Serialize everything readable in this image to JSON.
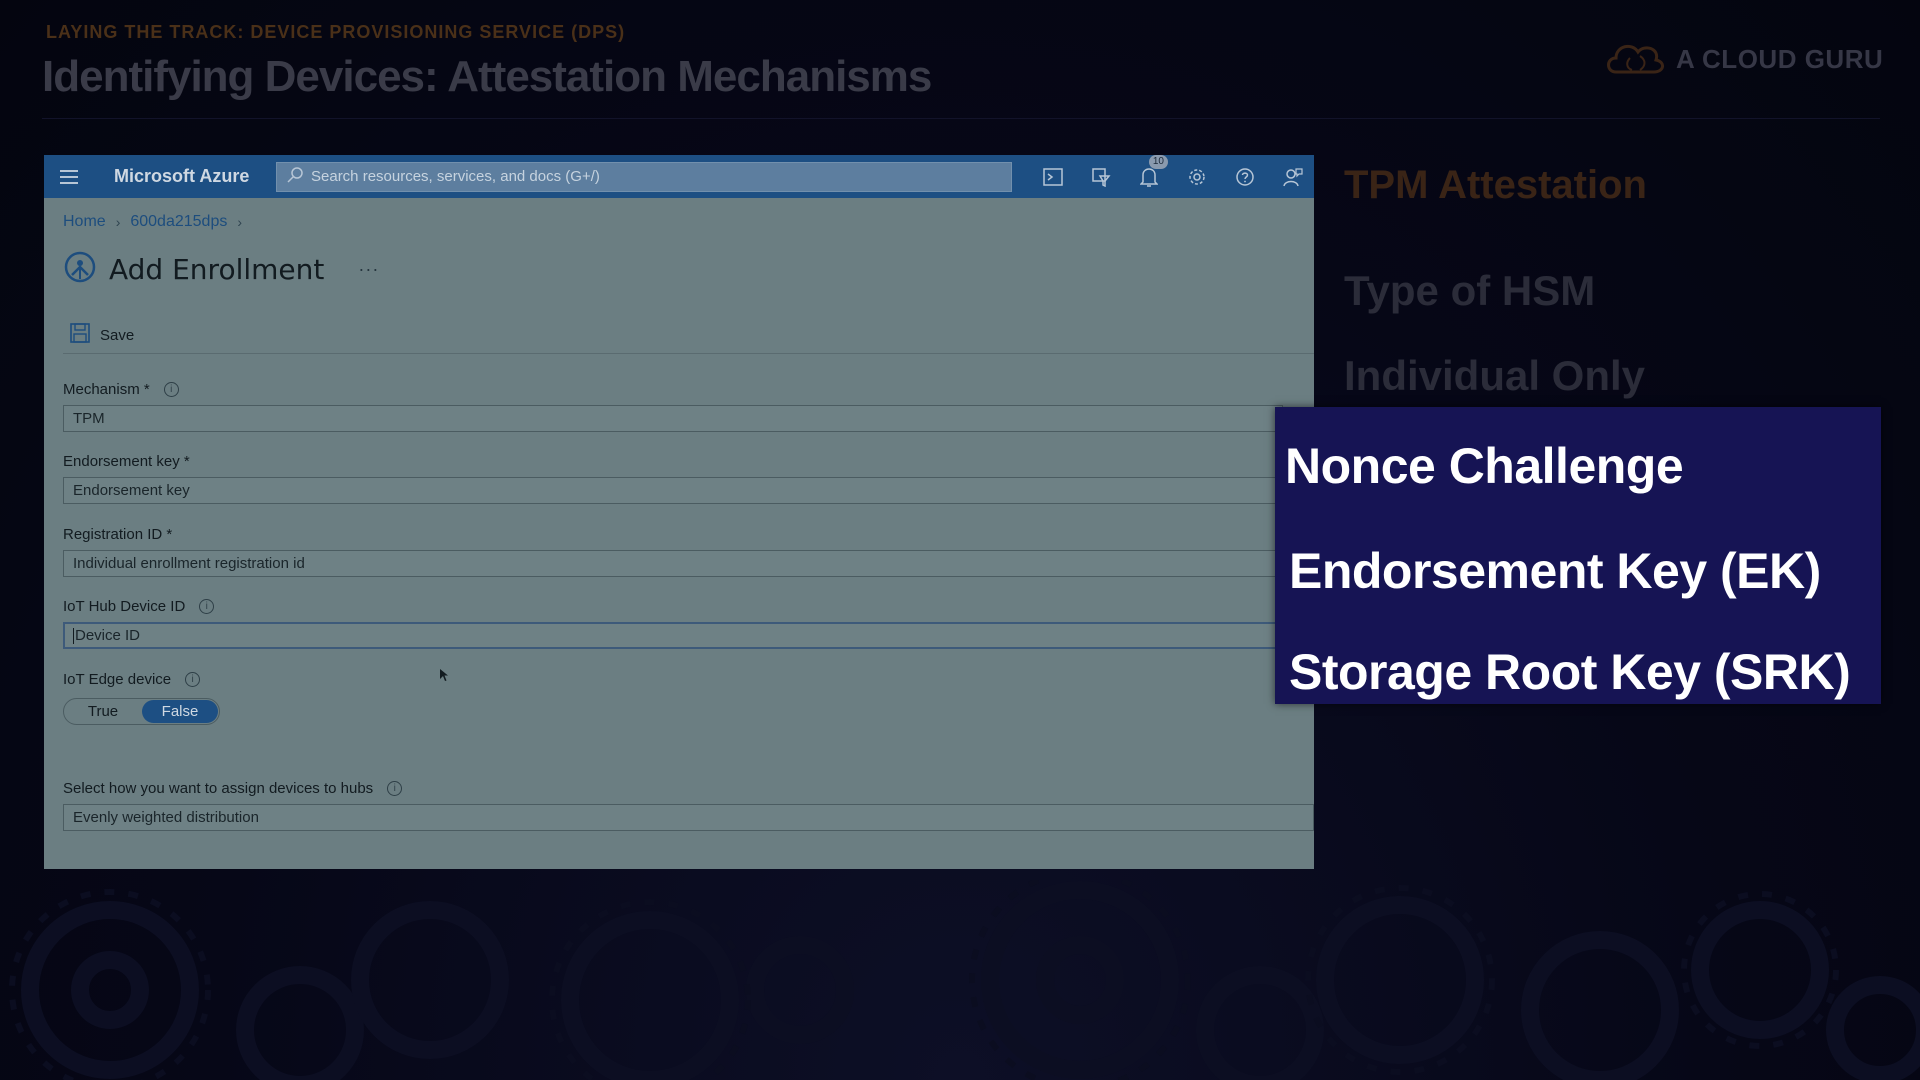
{
  "slide": {
    "subtitle": "LAYING THE TRACK: DEVICE PROVISIONING SERVICE (DPS)",
    "title": "Identifying Devices: Attestation Mechanisms",
    "brand": "A CLOUD GURU"
  },
  "portal": {
    "brand": "Microsoft Azure",
    "search_placeholder": "Search resources, services, and docs (G+/)",
    "notification_count": "10",
    "breadcrumb": [
      "Home",
      "600da215dps"
    ],
    "page_title": "Add Enrollment",
    "more_label": "···",
    "save_label": "Save",
    "fields": {
      "mechanism": {
        "label": "Mechanism *",
        "value": "TPM"
      },
      "endorsement_key": {
        "label": "Endorsement key *",
        "placeholder": "Endorsement key"
      },
      "registration_id": {
        "label": "Registration ID *",
        "placeholder": "Individual enrollment registration id"
      },
      "iot_hub_device_id": {
        "label": "IoT Hub Device ID",
        "placeholder": "Device ID"
      },
      "iot_edge_device": {
        "label": "IoT Edge device",
        "options": [
          "True",
          "False"
        ],
        "selected": "False"
      },
      "assign_hubs": {
        "label": "Select how you want to assign devices to hubs",
        "value": "Evenly weighted distribution"
      }
    }
  },
  "panel": {
    "title": "TPM Attestation",
    "hsm": "Type of HSM",
    "individual": "Individual Only",
    "callout": [
      "Nonce Challenge",
      "Endorsement Key (EK)",
      "Storage Root Key (SRK)"
    ]
  },
  "colors": {
    "background": "#050617",
    "azure_bar": "#1d4f83",
    "callout_bg": "#161454",
    "accent_orange": "#3a2416"
  },
  "icons": [
    "hamburger-icon",
    "search-icon",
    "cloud-shell-icon",
    "directory-filter-icon",
    "bell-icon",
    "gear-icon",
    "help-icon",
    "feedback-icon",
    "enrollment-icon",
    "save-icon",
    "info-icon",
    "cloud-logo-icon"
  ]
}
